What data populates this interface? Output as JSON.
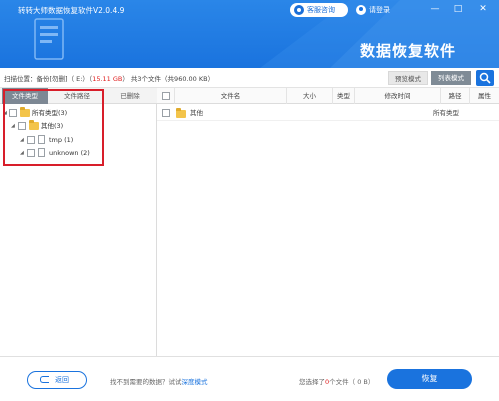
{
  "header": {
    "title": "转转大师数据恢复软件V2.0.4.9",
    "service_label": "客服咨询",
    "login_label": "请登录",
    "min_glyph": "—",
    "max_glyph": "□",
    "close_glyph": "✕",
    "brand": "数据恢复软件"
  },
  "scan": {
    "prefix": "扫描位置：备份[勿删]（ E:）（",
    "size": "15.11 GB",
    "suffix": "） 共3个文件（共960.00 KB）",
    "preview_mode": "预览模式",
    "list_mode": "列表模式"
  },
  "left_tabs": [
    "文件类型",
    "文件路径",
    "已删除"
  ],
  "tree": {
    "all_types": "所有类型(3)",
    "other": "其他(3)",
    "tmp": "tmp (1)",
    "unknown": "unknown (2)"
  },
  "table": {
    "headers": {
      "name": "文件名",
      "size": "大小",
      "type": "类型",
      "modified": "修改时间",
      "path": "路径",
      "attr": "属性"
    },
    "rows": [
      {
        "name": "其他",
        "size": "",
        "type": "",
        "modified": "",
        "path": "所有类型",
        "attr": ""
      }
    ]
  },
  "footer": {
    "back_label": "返回",
    "tip_prefix": "找不到需要的数据？试试",
    "deep_mode": "深度模式",
    "selected_prefix": "您选择了",
    "selected_count": "0",
    "selected_suffix": "个文件（ 0 B）",
    "recover_label": "恢复"
  },
  "colors": {
    "header_blue": "#1a73de",
    "accent_red": "#e02020",
    "highlight_box": "#d81e2a"
  }
}
